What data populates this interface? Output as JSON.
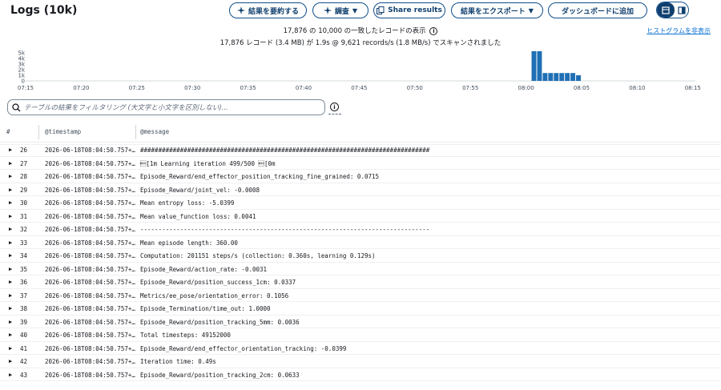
{
  "header": {
    "title": "Logs (10k)",
    "buttons": {
      "summarize": "結果を要約する",
      "patterns": "調査",
      "share": "Share results",
      "export": "結果をエクスポート",
      "dashboard": "ダッシュボードに追加"
    }
  },
  "histogram": {
    "summary_line1": "17,876 の 10,000 の一致したレコードの表示",
    "summary_line2": "17,876 レコード (3.4 MB) が 1.9s @ 9,621 records/s (1.8 MB/s) でスキャンされました",
    "hide_link": "ヒストグラムを非表示",
    "bar_color": "#1f6fb5"
  },
  "chart_data": {
    "type": "bar",
    "y_ticks": [
      "5k",
      "4k",
      "3k",
      "2k",
      "1k",
      "0"
    ],
    "ylim": [
      0,
      5000
    ],
    "x_ticks": [
      "07:15",
      "07:20",
      "07:25",
      "07:30",
      "07:35",
      "07:40",
      "07:45",
      "07:50",
      "07:55",
      "08:00",
      "08:05",
      "08:10",
      "08:15"
    ],
    "categories": [
      "08:00:30",
      "08:01:00",
      "08:01:30",
      "08:02:00",
      "08:02:30",
      "08:03:00",
      "08:03:30",
      "08:04:00",
      "08:04:30"
    ],
    "values": [
      5300,
      5300,
      1400,
      1400,
      1400,
      1400,
      1400,
      1400,
      1000
    ]
  },
  "filter": {
    "placeholder": "テーブルの結果をフィルタリング (大文字と小文字を区別しない)..."
  },
  "table": {
    "col_num": "#",
    "col_timestamp": "@timestamp",
    "col_message": "@message",
    "rows": [
      {
        "n": "26",
        "ts": "2026-06-18T08:04:50.757+…",
        "msg": "################################################################################"
      },
      {
        "n": "27",
        "ts": "2026-06-18T08:04:50.757+…",
        "msg": "\u001b[1m Learning iteration 499/500 \u001b[0m"
      },
      {
        "n": "28",
        "ts": "2026-06-18T08:04:50.757+…",
        "msg": "Episode_Reward/end_effector_position_tracking_fine_grained: 0.0715"
      },
      {
        "n": "29",
        "ts": "2026-06-18T08:04:50.757+…",
        "msg": "Episode_Reward/joint_vel: -0.0008"
      },
      {
        "n": "30",
        "ts": "2026-06-18T08:04:50.757+…",
        "msg": "Mean entropy loss: -5.0399"
      },
      {
        "n": "31",
        "ts": "2026-06-18T08:04:50.757+…",
        "msg": "Mean value_function loss: 0.0041"
      },
      {
        "n": "32",
        "ts": "2026-06-18T08:04:50.757+…",
        "msg": "--------------------------------------------------------------------------------"
      },
      {
        "n": "33",
        "ts": "2026-06-18T08:04:50.757+…",
        "msg": "Mean episode length: 360.00"
      },
      {
        "n": "34",
        "ts": "2026-06-18T08:04:50.757+…",
        "msg": "Computation: 201151 steps/s (collection: 0.360s, learning 0.129s)"
      },
      {
        "n": "35",
        "ts": "2026-06-18T08:04:50.757+…",
        "msg": "Episode_Reward/action_rate: -0.0031"
      },
      {
        "n": "36",
        "ts": "2026-06-18T08:04:50.757+…",
        "msg": "Episode_Reward/position_success_1cm: 0.0337"
      },
      {
        "n": "37",
        "ts": "2026-06-18T08:04:50.757+…",
        "msg": "Metrics/ee_pose/orientation_error: 0.1056"
      },
      {
        "n": "38",
        "ts": "2026-06-18T08:04:50.757+…",
        "msg": "Episode_Termination/time_out: 1.0000"
      },
      {
        "n": "39",
        "ts": "2026-06-18T08:04:50.757+…",
        "msg": "Episode_Reward/position_tracking_5mm: 0.0036"
      },
      {
        "n": "40",
        "ts": "2026-06-18T08:04:50.757+…",
        "msg": "Total timesteps: 49152000"
      },
      {
        "n": "41",
        "ts": "2026-06-18T08:04:50.757+…",
        "msg": "Episode_Reward/end_effector_orientation_tracking: -0.0399"
      },
      {
        "n": "42",
        "ts": "2026-06-18T08:04:50.757+…",
        "msg": "Iteration time: 0.49s"
      },
      {
        "n": "43",
        "ts": "2026-06-18T08:04:50.757+…",
        "msg": "Episode_Reward/position_tracking_2cm: 0.0633"
      }
    ]
  }
}
